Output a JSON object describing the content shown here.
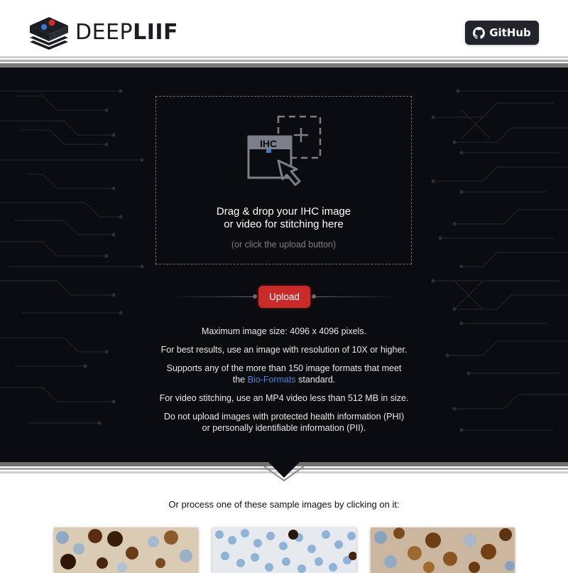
{
  "header": {
    "logo": {
      "icon": "deepliif-logo-icon",
      "text_light": "DEEP",
      "text_bold": "LIIF"
    },
    "github": {
      "label": "GitHub",
      "icon": "github-icon"
    }
  },
  "upload_zone": {
    "icon_label": "IHC",
    "icon": "upload-image-cursor-icon",
    "main_line1": "Drag & drop your IHC image",
    "main_line2": "or video for stitching here",
    "sub_text": "(or click the upload button)"
  },
  "upload_button": {
    "label": "Upload",
    "color": "#c92a2a"
  },
  "info": {
    "max_size": "Maximum image size: 4096 x 4096 pixels.",
    "best_results": "For best results, use an image with resolution of 10X or higher.",
    "formats_line1": "Supports any of the more than 150 image formats that meet",
    "formats_pre": "the ",
    "formats_link": "Bio-Formats",
    "formats_post": " standard.",
    "video": "For video stitching, use an MP4 video less than 512 MB in size.",
    "phi_line1": "Do not upload images with protected health information (PHI)",
    "phi_line2": "or personally identifiable information (PII)."
  },
  "samples": {
    "title": "Or process one of these sample images by clicking on it:",
    "items": [
      "sample-ihc-image-1",
      "sample-ihc-image-2",
      "sample-ihc-image-3"
    ]
  },
  "colors": {
    "hero_bg": "#0b0c0f",
    "link": "#4b83d8",
    "github_bg": "#22252c"
  }
}
